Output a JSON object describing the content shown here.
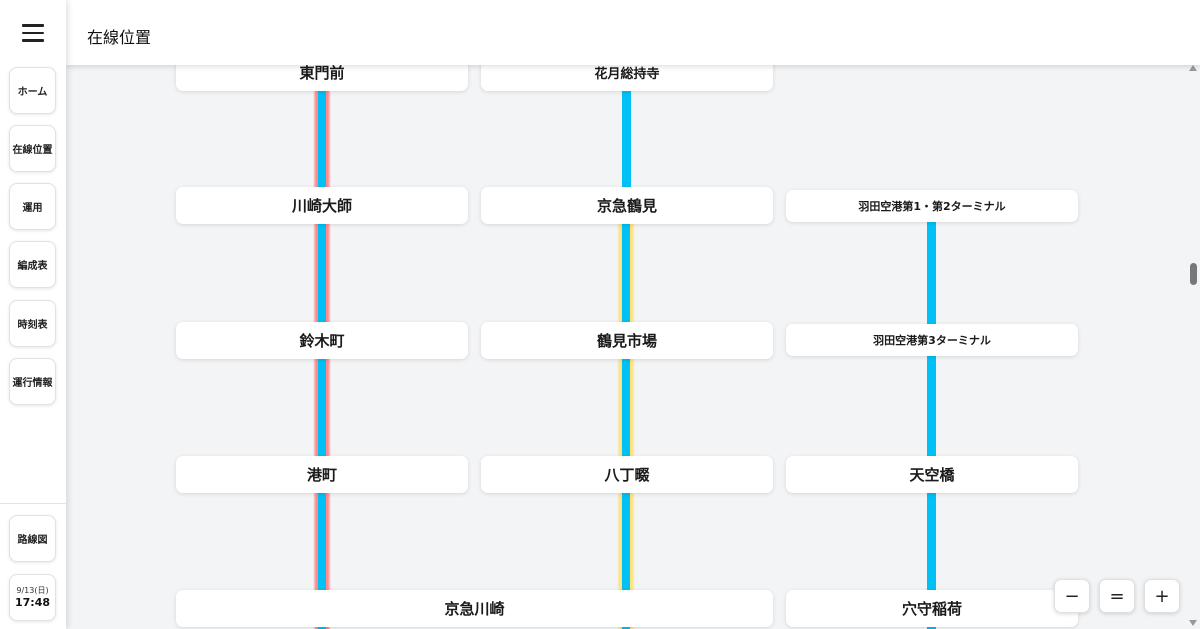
{
  "header": {
    "title": "在線位置"
  },
  "sidebar": {
    "menu_icon": "hamburger-menu-icon",
    "items": [
      {
        "label": "ホーム"
      },
      {
        "label": "在線位置"
      },
      {
        "label": "運用"
      },
      {
        "label": "編成表"
      },
      {
        "label": "時刻表"
      },
      {
        "label": "運行情報"
      }
    ],
    "route_map": "路線図",
    "clock": {
      "date": "9/13(日)",
      "time": "17:48"
    }
  },
  "stations": {
    "col1": [
      "東門前",
      "川崎大師",
      "鈴木町",
      "港町"
    ],
    "col2": [
      "花月総持寺",
      "京急鶴見",
      "鶴見市場",
      "八丁畷"
    ],
    "col3": [
      "羽田空港第1・第2ターミナル",
      "羽田空港第3ターミナル",
      "天空橋",
      "穴守稲荷"
    ],
    "wide": "京急川崎"
  },
  "zoom": {
    "minus": "−",
    "reset": "=",
    "plus": "+"
  },
  "colors": {
    "track_blue": "#00c0f5",
    "track_red": "#ff8a8a",
    "track_yellow": "#ffe27a",
    "background": "#f3f4f6"
  }
}
